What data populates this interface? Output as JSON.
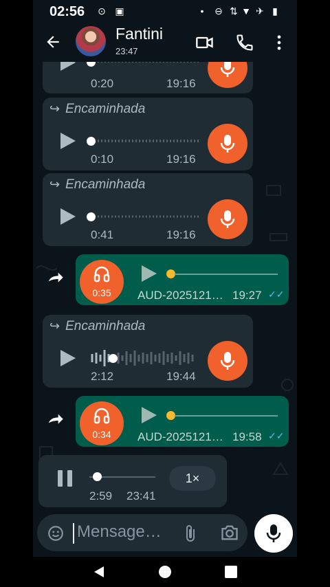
{
  "status_bar": {
    "time": "02:56"
  },
  "header": {
    "contact_name": "Fantini",
    "last_seen": "23:47"
  },
  "forwarded_label": "Encaminhada",
  "messages": [
    {
      "type": "incoming-audio",
      "duration": "0:20",
      "time": "19:16",
      "forwarded": false
    },
    {
      "type": "incoming-audio",
      "duration": "0:10",
      "time": "19:16",
      "forwarded": true
    },
    {
      "type": "incoming-audio",
      "duration": "0:41",
      "time": "19:16",
      "forwarded": true
    },
    {
      "type": "outgoing-audio",
      "duration": "0:35",
      "filename": "AUD-2025121…",
      "time": "19:27"
    },
    {
      "type": "incoming-audio",
      "duration": "2:12",
      "time": "19:44",
      "forwarded": true
    },
    {
      "type": "outgoing-audio",
      "duration": "0:34",
      "filename": "AUD-2025121…",
      "time": "19:58"
    }
  ],
  "player": {
    "elapsed": "2:59",
    "time": "23:41",
    "speed": "1×",
    "progress": 0.05
  },
  "composer": {
    "placeholder": "Mensage…"
  },
  "colors": {
    "background": "#0b141a",
    "incoming": "#202c33",
    "outgoing": "#005c4b",
    "accent": "#f0612b",
    "read_ticks": "#53bdeb"
  },
  "icons": [
    "back-arrow-icon",
    "video-call-icon",
    "phone-icon",
    "more-icon",
    "play-icon",
    "mic-icon",
    "headphones-icon",
    "forward-icon",
    "pause-icon",
    "sticker-icon",
    "attach-icon",
    "camera-icon",
    "mic-icon"
  ]
}
